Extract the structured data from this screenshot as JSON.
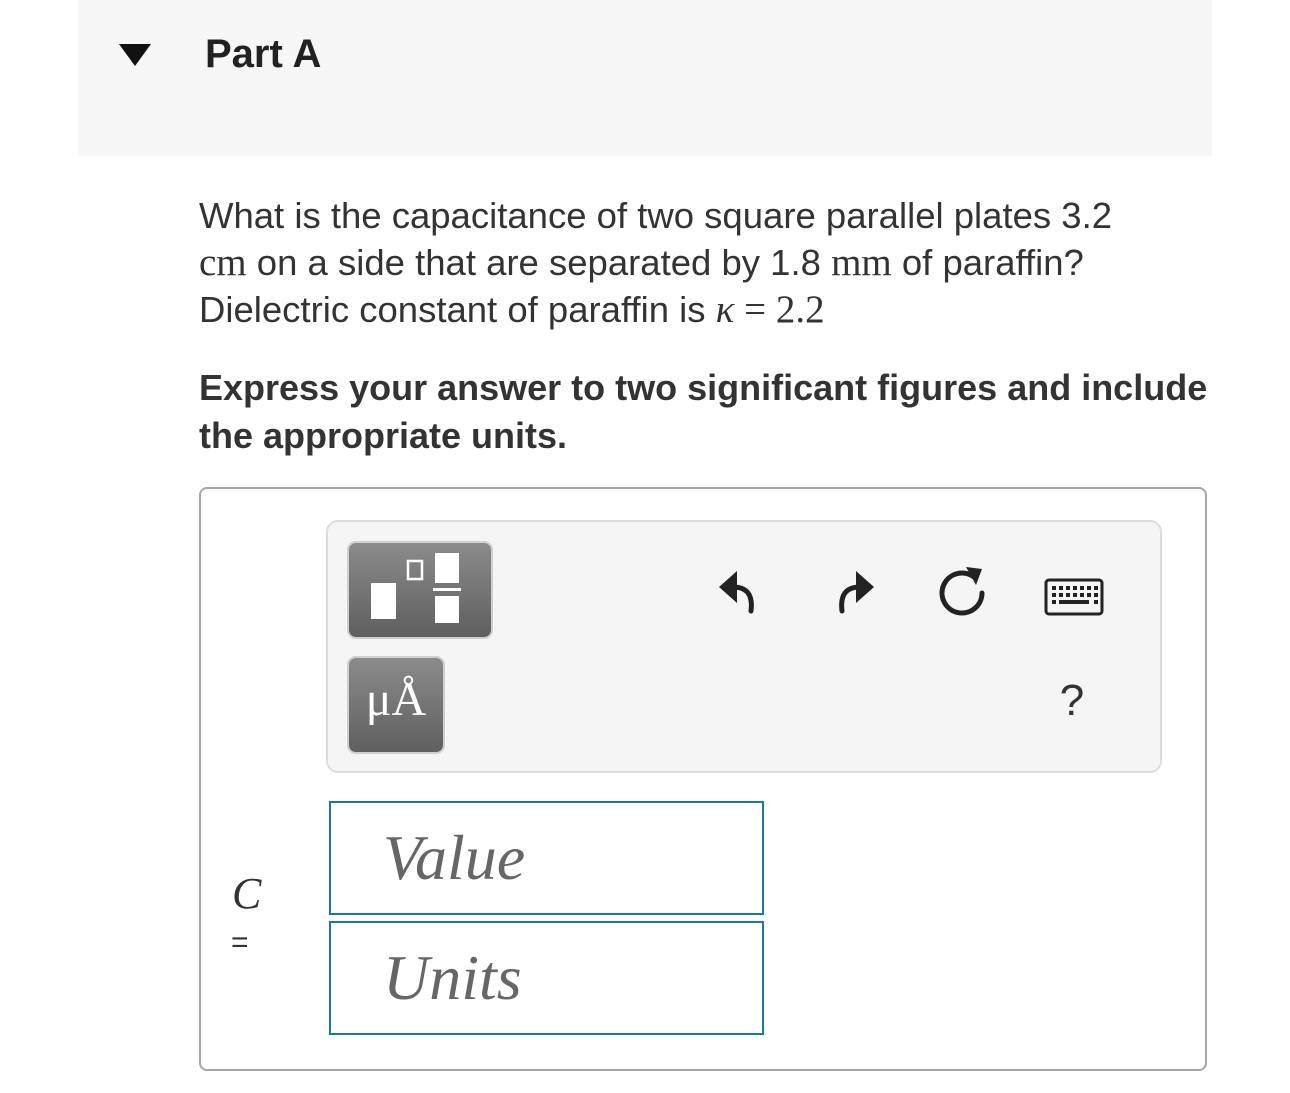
{
  "part": {
    "title": "Part A"
  },
  "question": {
    "line1": "What is the capacitance of two square parallel plates 3.2",
    "unit_cm": "cm",
    "line2_mid": " on a side that are separated by 1.8 ",
    "unit_mm": "mm",
    "line2_end": " of paraffin?",
    "line3": "Dielectric constant of paraffin is ",
    "kappa_symbol": "κ",
    "kappa_equals": " = 2.2"
  },
  "instruction": "Express your answer to two significant figures and include the appropriate units.",
  "toolbar": {
    "units_button_label": "μÅ",
    "help_label": "?"
  },
  "answer": {
    "variable": "C",
    "equals": "=",
    "value_placeholder": "Value",
    "units_placeholder": "Units"
  }
}
